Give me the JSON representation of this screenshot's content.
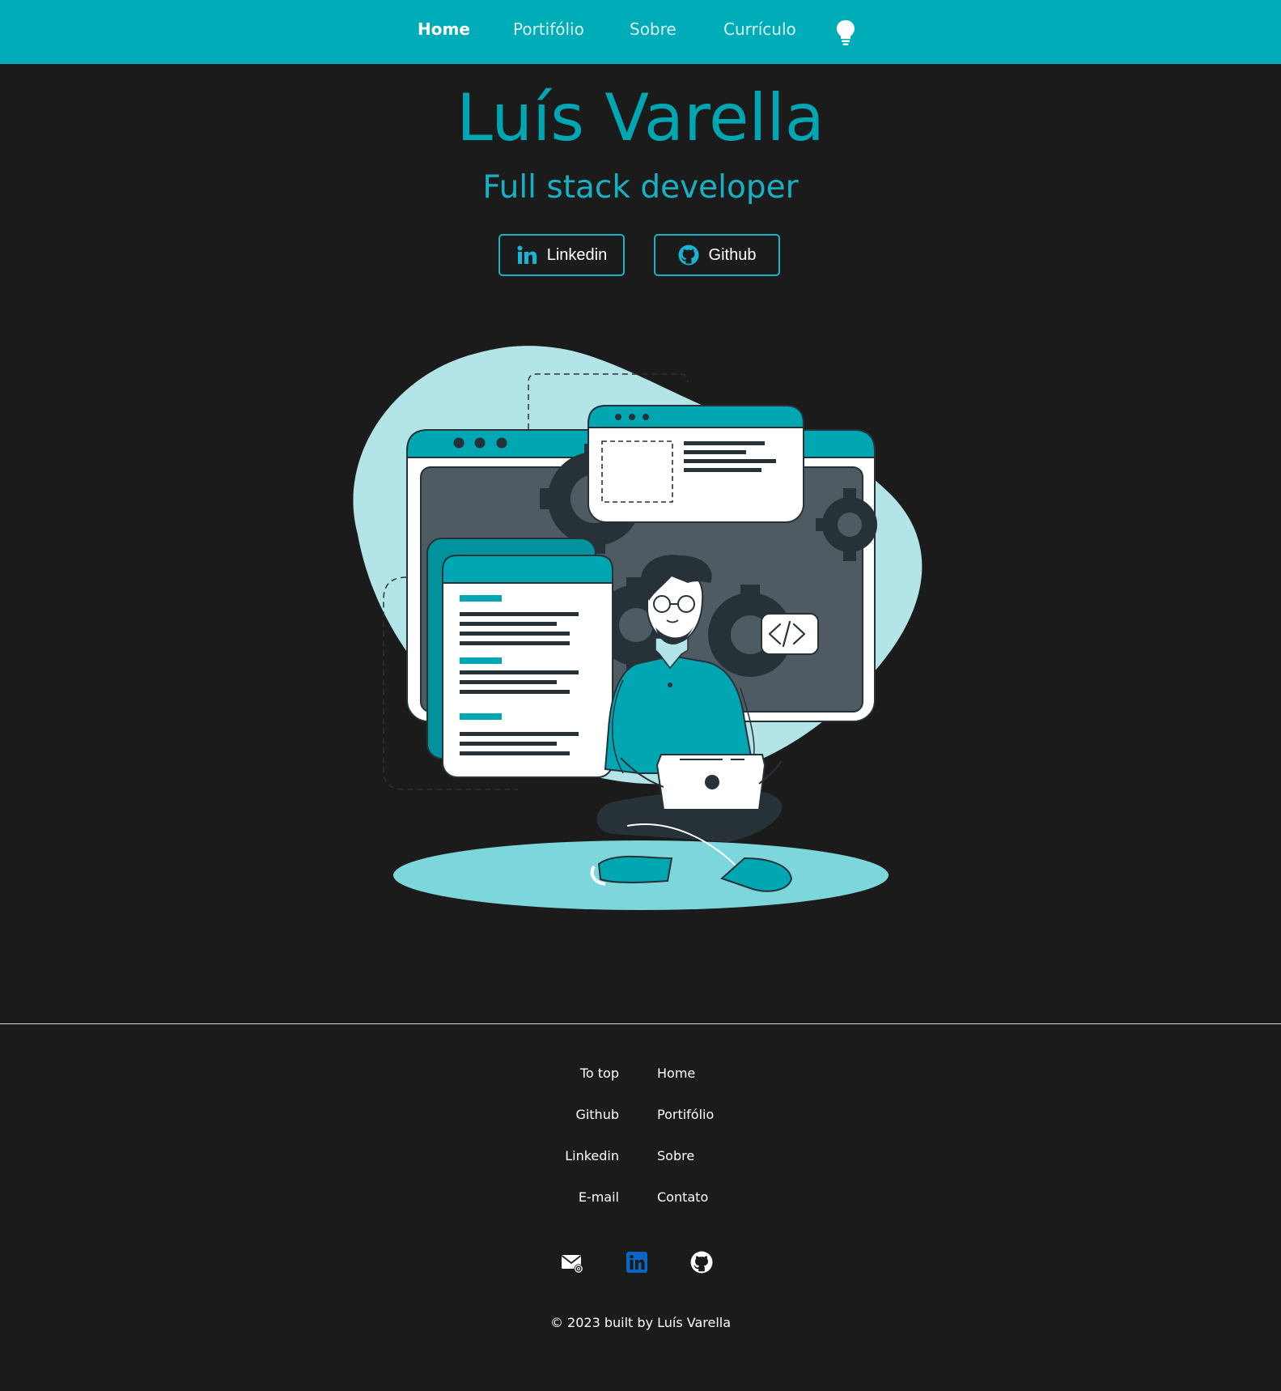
{
  "nav": {
    "items": [
      {
        "label": "Home",
        "active": true
      },
      {
        "label": "Portifólio"
      },
      {
        "label": "Sobre"
      },
      {
        "label": "Currículo"
      }
    ],
    "theme_toggle_icon": "lightbulb-icon"
  },
  "hero": {
    "name": "Luís Varella",
    "role": "Full stack developer",
    "buttons": [
      {
        "label": "Linkedin",
        "icon": "linkedin-icon"
      },
      {
        "label": "Github",
        "icon": "github-icon"
      }
    ]
  },
  "footer": {
    "left_links": [
      "To top",
      "Github",
      "Linkedin",
      "E-mail"
    ],
    "right_links": [
      "Home",
      "Portifólio",
      "Sobre",
      "Contato"
    ],
    "social_icons": [
      "mail-icon",
      "linkedin-icon",
      "github-icon"
    ],
    "copyright": "© 2023 built by Luís Varella"
  },
  "colors": {
    "accent": "#00acb7",
    "background": "#1b1b1b",
    "title": "#00a7b3",
    "linkedin_blue": "#0a66c2"
  }
}
